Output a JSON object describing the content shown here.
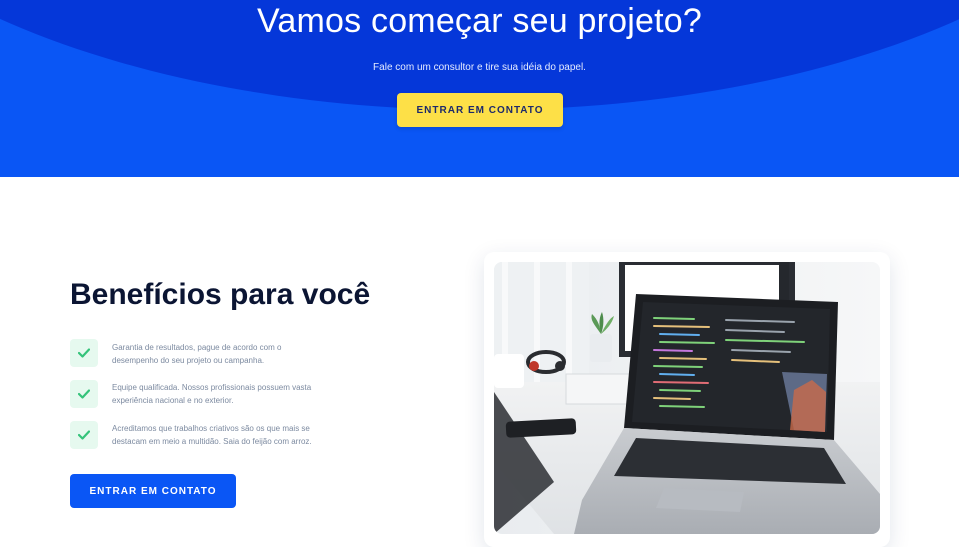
{
  "hero": {
    "title": "Vamos começar seu projeto?",
    "subtitle": "Fale com um consultor e tire sua idéia do papel.",
    "button_label": "ENTRAR EM CONTATO"
  },
  "benefits": {
    "title": "Benefícios para você",
    "items": [
      {
        "text": "Garantia de resultados, pague de acordo com o desempenho do seu projeto ou campanha."
      },
      {
        "text": "Equipe qualificada. Nossos profissionais possuem vasta experiência nacional e no exterior."
      },
      {
        "text": "Acreditamos que trabalhos criativos são os que mais se destacam em meio a multidão. Saia do feijão com arroz."
      }
    ],
    "button_label": "ENTRAR EM CONTATO"
  },
  "colors": {
    "hero_blue": "#0a56f5",
    "hero_arc": "#0537d9",
    "yellow_button": "#fde047",
    "check_green": "#34c37a",
    "title_dark": "#0b1533"
  },
  "icons": {
    "check": "check-icon"
  }
}
